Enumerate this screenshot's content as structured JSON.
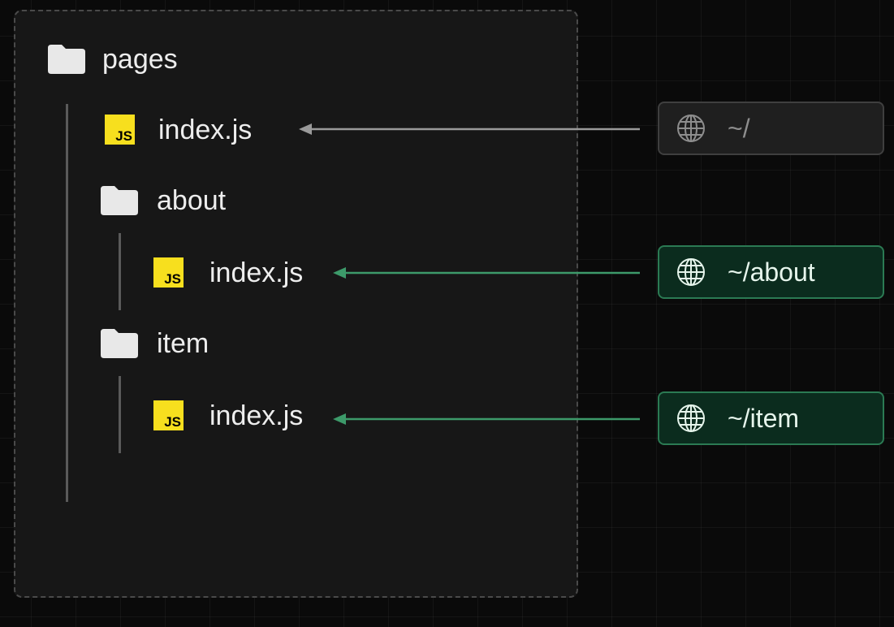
{
  "tree": {
    "root": {
      "label": "pages",
      "icon": "folder-icon"
    },
    "files": [
      {
        "label": "index.js",
        "icon": "js-icon",
        "icon_text": "JS"
      },
      {
        "label": "index.js",
        "icon": "js-icon",
        "icon_text": "JS"
      },
      {
        "label": "index.js",
        "icon": "js-icon",
        "icon_text": "JS"
      }
    ],
    "folders": [
      {
        "label": "about",
        "icon": "folder-icon"
      },
      {
        "label": "item",
        "icon": "folder-icon"
      }
    ]
  },
  "routes": [
    {
      "path": "~/",
      "icon": "globe-icon",
      "highlighted": false
    },
    {
      "path": "~/about",
      "icon": "globe-icon",
      "highlighted": true
    },
    {
      "path": "~/item",
      "icon": "globe-icon",
      "highlighted": true
    }
  ],
  "colors": {
    "background": "#0a0a0a",
    "panel": "#171717",
    "js_yellow": "#f7df1e",
    "green_arrow": "#3d9a6a",
    "grey_arrow": "#9a9a9a"
  }
}
